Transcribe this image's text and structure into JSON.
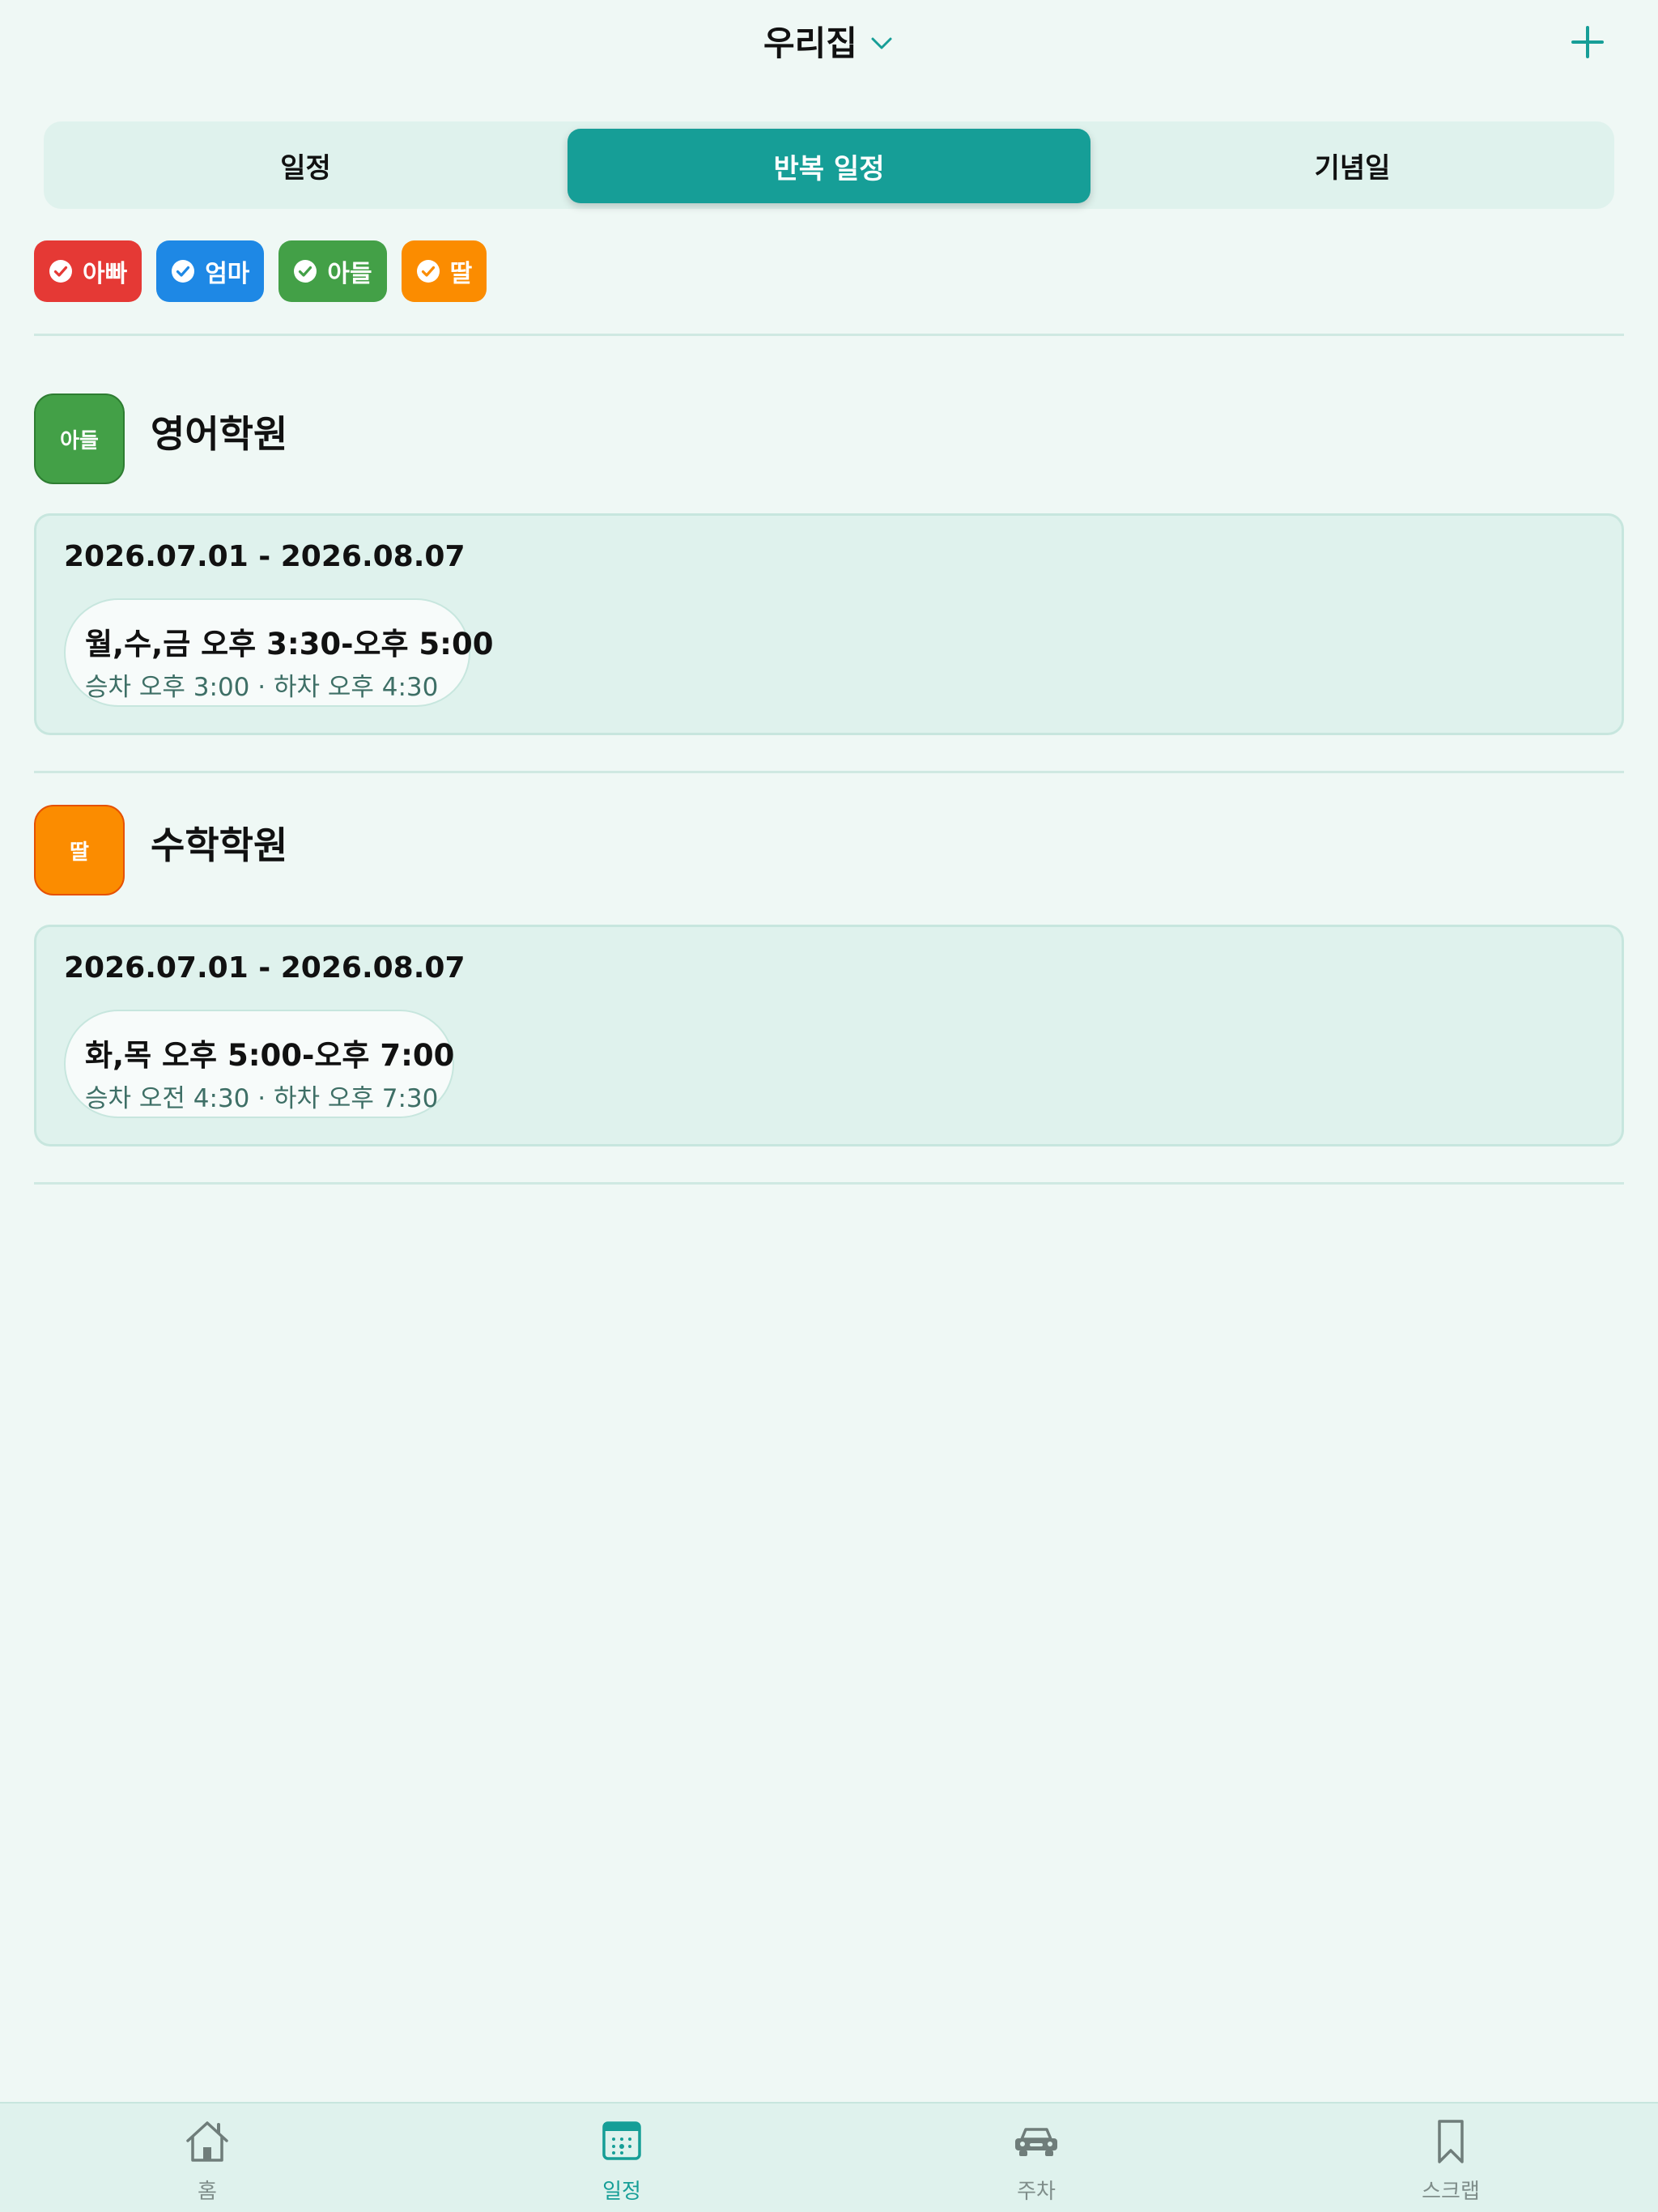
{
  "header": {
    "title": "우리집",
    "chevron_icon": "chevron-down-icon",
    "add_icon": "plus-icon",
    "accent_color": "#169e97"
  },
  "segment": {
    "tabs": [
      {
        "label": "일정",
        "selected": false
      },
      {
        "label": "반복 일정",
        "selected": true
      },
      {
        "label": "기념일",
        "selected": false
      }
    ]
  },
  "filters": [
    {
      "label": "아빠",
      "color": "#e53935",
      "checked": true
    },
    {
      "label": "엄마",
      "color": "#1e88e5",
      "checked": true
    },
    {
      "label": "아들",
      "color": "#43a047",
      "checked": true
    },
    {
      "label": "딸",
      "color": "#fb8c00",
      "checked": true
    }
  ],
  "groups": [
    {
      "member": "아들",
      "member_color": "#43a047",
      "title": "영어학원",
      "range": "2026.07.01 - 2026.08.07",
      "time": "월,수,금 오후 3:30-오후 5:00",
      "detail": "승차 오후 3:00 · 하차 오후 4:30"
    },
    {
      "member": "딸",
      "member_color": "#fb8c00",
      "title": "수학학원",
      "range": "2026.07.01 - 2026.08.07",
      "time": "화,목 오후 5:00-오후 7:00",
      "detail": "승차 오전 4:30 · 하차 오후 7:30"
    }
  ],
  "tabbar": {
    "items": [
      {
        "label": "홈",
        "icon": "home-icon",
        "active": false
      },
      {
        "label": "일정",
        "icon": "calendar-icon",
        "active": true
      },
      {
        "label": "주차",
        "icon": "car-icon",
        "active": false
      },
      {
        "label": "스크랩",
        "icon": "bookmark-icon",
        "active": false
      }
    ],
    "active_color": "#169e97",
    "inactive_color": "#7f8d8a"
  }
}
